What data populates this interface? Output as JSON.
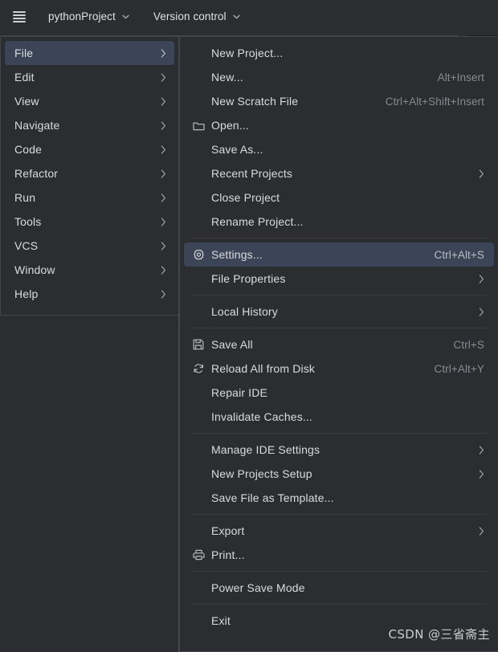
{
  "toolbar": {
    "menu_icon": "hamburger-icon",
    "project_name": "pythonProject",
    "project_chevron": "⌄",
    "version_control": "Version control",
    "vcs_chevron": "⌄"
  },
  "main_menu": {
    "items": [
      {
        "label": "File",
        "arrow": "›",
        "selected": true
      },
      {
        "label": "Edit",
        "arrow": "›",
        "selected": false
      },
      {
        "label": "View",
        "arrow": "›",
        "selected": false
      },
      {
        "label": "Navigate",
        "arrow": "›",
        "selected": false
      },
      {
        "label": "Code",
        "arrow": "›",
        "selected": false
      },
      {
        "label": "Refactor",
        "arrow": "›",
        "selected": false
      },
      {
        "label": "Run",
        "arrow": "›",
        "selected": false
      },
      {
        "label": "Tools",
        "arrow": "›",
        "selected": false
      },
      {
        "label": "VCS",
        "arrow": "›",
        "selected": false
      },
      {
        "label": "Window",
        "arrow": "›",
        "selected": false
      },
      {
        "label": "Help",
        "arrow": "›",
        "selected": false
      }
    ]
  },
  "file_menu": {
    "items": [
      {
        "type": "item",
        "label": "New Project...",
        "shortcut": "",
        "icon": "",
        "arrow": "",
        "selected": false
      },
      {
        "type": "item",
        "label": "New...",
        "shortcut": "Alt+Insert",
        "icon": "",
        "arrow": "",
        "selected": false
      },
      {
        "type": "item",
        "label": "New Scratch File",
        "shortcut": "Ctrl+Alt+Shift+Insert",
        "icon": "",
        "arrow": "",
        "selected": false
      },
      {
        "type": "item",
        "label": "Open...",
        "shortcut": "",
        "icon": "folder-icon",
        "arrow": "",
        "selected": false
      },
      {
        "type": "item",
        "label": "Save As...",
        "shortcut": "",
        "icon": "",
        "arrow": "",
        "selected": false
      },
      {
        "type": "item",
        "label": "Recent Projects",
        "shortcut": "",
        "icon": "",
        "arrow": "›",
        "selected": false
      },
      {
        "type": "item",
        "label": "Close Project",
        "shortcut": "",
        "icon": "",
        "arrow": "",
        "selected": false
      },
      {
        "type": "item",
        "label": "Rename Project...",
        "shortcut": "",
        "icon": "",
        "arrow": "",
        "selected": false
      },
      {
        "type": "separator"
      },
      {
        "type": "item",
        "label": "Settings...",
        "shortcut": "Ctrl+Alt+S",
        "icon": "gear-icon",
        "arrow": "",
        "selected": true
      },
      {
        "type": "item",
        "label": "File Properties",
        "shortcut": "",
        "icon": "",
        "arrow": "›",
        "selected": false
      },
      {
        "type": "separator"
      },
      {
        "type": "item",
        "label": "Local History",
        "shortcut": "",
        "icon": "",
        "arrow": "›",
        "selected": false
      },
      {
        "type": "separator"
      },
      {
        "type": "item",
        "label": "Save All",
        "shortcut": "Ctrl+S",
        "icon": "save-icon",
        "arrow": "",
        "selected": false
      },
      {
        "type": "item",
        "label": "Reload All from Disk",
        "shortcut": "Ctrl+Alt+Y",
        "icon": "reload-icon",
        "arrow": "",
        "selected": false
      },
      {
        "type": "item",
        "label": "Repair IDE",
        "shortcut": "",
        "icon": "",
        "arrow": "",
        "selected": false
      },
      {
        "type": "item",
        "label": "Invalidate Caches...",
        "shortcut": "",
        "icon": "",
        "arrow": "",
        "selected": false
      },
      {
        "type": "separator"
      },
      {
        "type": "item",
        "label": "Manage IDE Settings",
        "shortcut": "",
        "icon": "",
        "arrow": "›",
        "selected": false
      },
      {
        "type": "item",
        "label": "New Projects Setup",
        "shortcut": "",
        "icon": "",
        "arrow": "›",
        "selected": false
      },
      {
        "type": "item",
        "label": "Save File as Template...",
        "shortcut": "",
        "icon": "",
        "arrow": "",
        "selected": false
      },
      {
        "type": "separator"
      },
      {
        "type": "item",
        "label": "Export",
        "shortcut": "",
        "icon": "",
        "arrow": "›",
        "selected": false
      },
      {
        "type": "item",
        "label": "Print...",
        "shortcut": "",
        "icon": "print-icon",
        "arrow": "",
        "selected": false
      },
      {
        "type": "separator"
      },
      {
        "type": "item",
        "label": "Power Save Mode",
        "shortcut": "",
        "icon": "",
        "arrow": "",
        "selected": false
      },
      {
        "type": "separator"
      },
      {
        "type": "item",
        "label": "Exit",
        "shortcut": "",
        "icon": "",
        "arrow": "",
        "selected": false
      }
    ]
  },
  "watermark": {
    "text": "CSDN @三省斋主"
  },
  "colors": {
    "background": "#2b2d30",
    "popup_background": "#2b2d30",
    "popup_border": "#43454a",
    "selection": "#3b4557",
    "text": "#dadbde",
    "muted_text": "#868a91",
    "separator": "#393b40"
  }
}
